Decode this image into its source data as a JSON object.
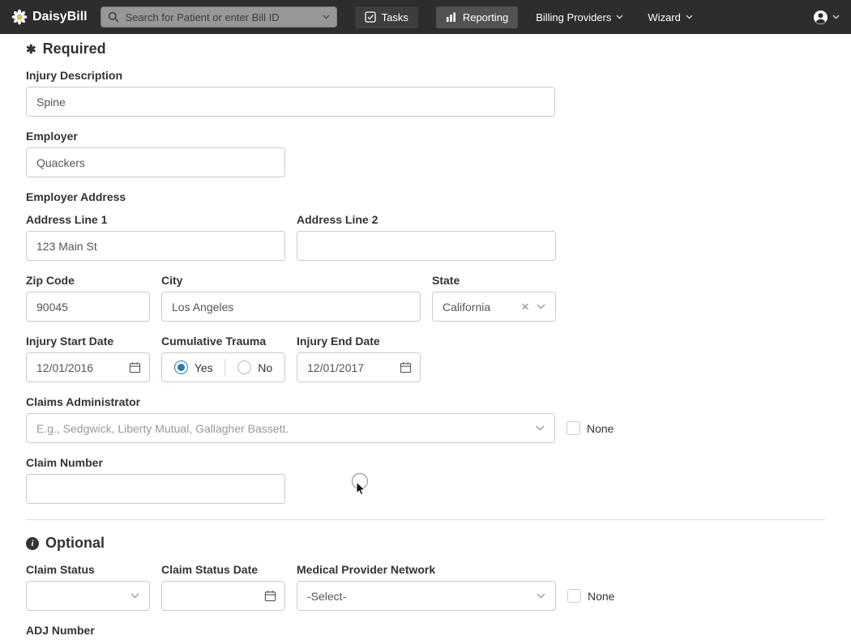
{
  "navbar": {
    "brand": "DaisyBill",
    "search": {
      "placeholder": "Search for Patient or enter Bill ID"
    },
    "tasks_label": "Tasks",
    "reporting_label": "Reporting",
    "billing_providers_label": "Billing Providers",
    "wizard_label": "Wizard"
  },
  "icons": {
    "required_glyph": "✱",
    "info_glyph": "i",
    "clear_glyph": "×"
  },
  "required": {
    "title": "Required",
    "injury_description": {
      "label": "Injury Description",
      "value": "Spine"
    },
    "employer": {
      "label": "Employer",
      "value": "Quackers"
    },
    "employer_address_label": "Employer Address",
    "address1": {
      "label": "Address Line 1",
      "value": "123 Main St"
    },
    "address2": {
      "label": "Address Line 2",
      "value": ""
    },
    "zip": {
      "label": "Zip Code",
      "value": "90045"
    },
    "city": {
      "label": "City",
      "value": "Los Angeles"
    },
    "state": {
      "label": "State",
      "value": "California"
    },
    "injury_start": {
      "label": "Injury Start Date",
      "value": "12/01/2016"
    },
    "cumulative_trauma": {
      "label": "Cumulative Trauma",
      "yes": "Yes",
      "no": "No",
      "selected": "Yes"
    },
    "injury_end": {
      "label": "Injury End Date",
      "value": "12/01/2017"
    },
    "claims_admin": {
      "label": "Claims Administrator",
      "placeholder": "E.g., Sedgwick, Liberty Mutual, Gallagher Bassett.",
      "none_label": "None"
    },
    "claim_number": {
      "label": "Claim Number",
      "value": ""
    }
  },
  "optional": {
    "title": "Optional",
    "claim_status": {
      "label": "Claim Status",
      "value": ""
    },
    "claim_status_date": {
      "label": "Claim Status Date",
      "value": ""
    },
    "mpn": {
      "label": "Medical Provider Network",
      "value": "-Select-"
    },
    "none_label": "None",
    "adj_number": {
      "label": "ADJ Number"
    }
  },
  "colors": {
    "navbar_bg": "#2d2d2d",
    "accent_blue": "#2a7ab9"
  }
}
